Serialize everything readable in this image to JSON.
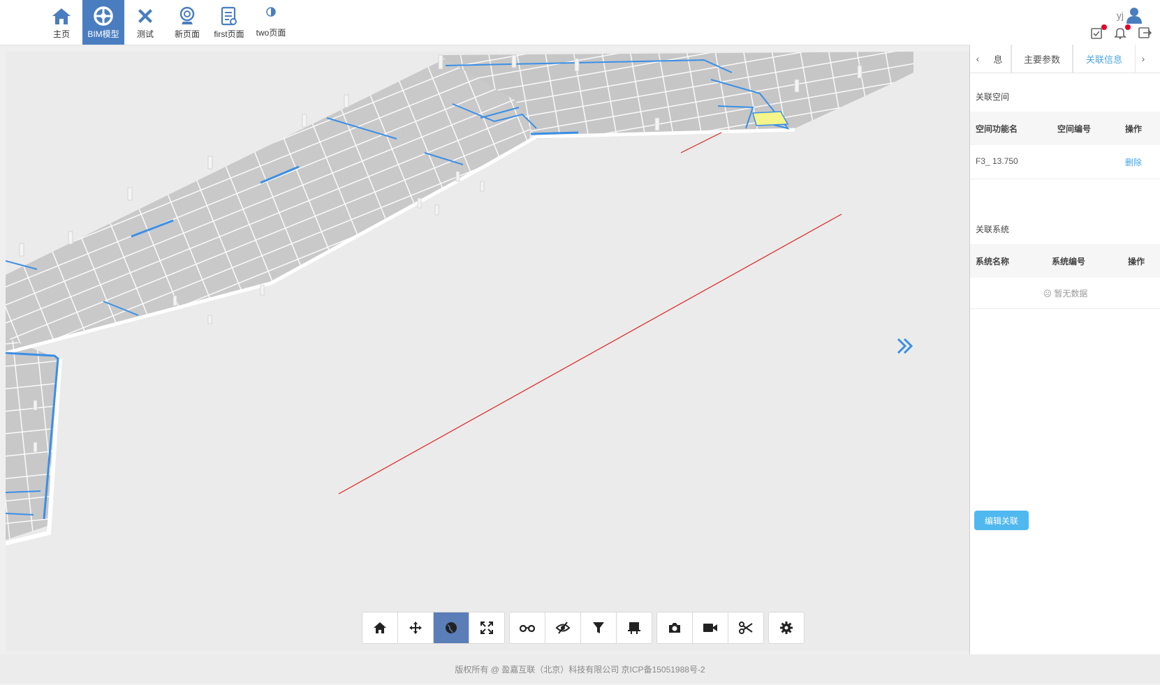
{
  "nav": {
    "items": [
      {
        "label": "主页",
        "icon": "home-icon"
      },
      {
        "label": "BIM模型",
        "icon": "bim-model-icon"
      },
      {
        "label": "测试",
        "icon": "tools-icon"
      },
      {
        "label": "新页面",
        "icon": "webcam-icon"
      },
      {
        "label": "first页面",
        "icon": "document-icon"
      },
      {
        "label": "two页面",
        "icon": "contrast-icon"
      }
    ],
    "active_index": 1
  },
  "user": {
    "name": "yj",
    "icons": [
      "user-icon",
      "task-icon",
      "bell-icon",
      "logout-icon"
    ]
  },
  "panel": {
    "tabs": [
      "息",
      "主要参数",
      "关联信息"
    ],
    "active_tab": "关联信息",
    "related_space": {
      "title": "关联空间",
      "columns": [
        "空间功能名",
        "空间编号",
        "操作"
      ],
      "rows": [
        {
          "name": "F3_ 13.750",
          "code": "",
          "action": "删除"
        }
      ]
    },
    "related_system": {
      "title": "关联系统",
      "columns": [
        "系统名称",
        "系统编号",
        "操作"
      ],
      "empty_text": "暂无数据"
    },
    "edit_button": "编辑关联"
  },
  "toolbar": {
    "groups": [
      [
        "home-icon",
        "move-icon",
        "orbit-icon",
        "fullscreen-icon"
      ],
      [
        "glasses-icon",
        "hide-icon",
        "filter-icon",
        "presentation-icon"
      ],
      [
        "camera-icon",
        "video-icon",
        "scissors-icon"
      ],
      [
        "settings-icon"
      ]
    ],
    "active": "orbit-icon"
  },
  "footer": {
    "text": "版权所有 @ 盈嘉互联（北京）科技有限公司 京ICP备15051988号-2"
  },
  "colors": {
    "accent": "#4a7dbf",
    "link": "#41a7e6",
    "button": "#4fb8ef",
    "highlight": "#f5f58a",
    "pipe": "#3a8fe6",
    "line": "#e02020"
  }
}
